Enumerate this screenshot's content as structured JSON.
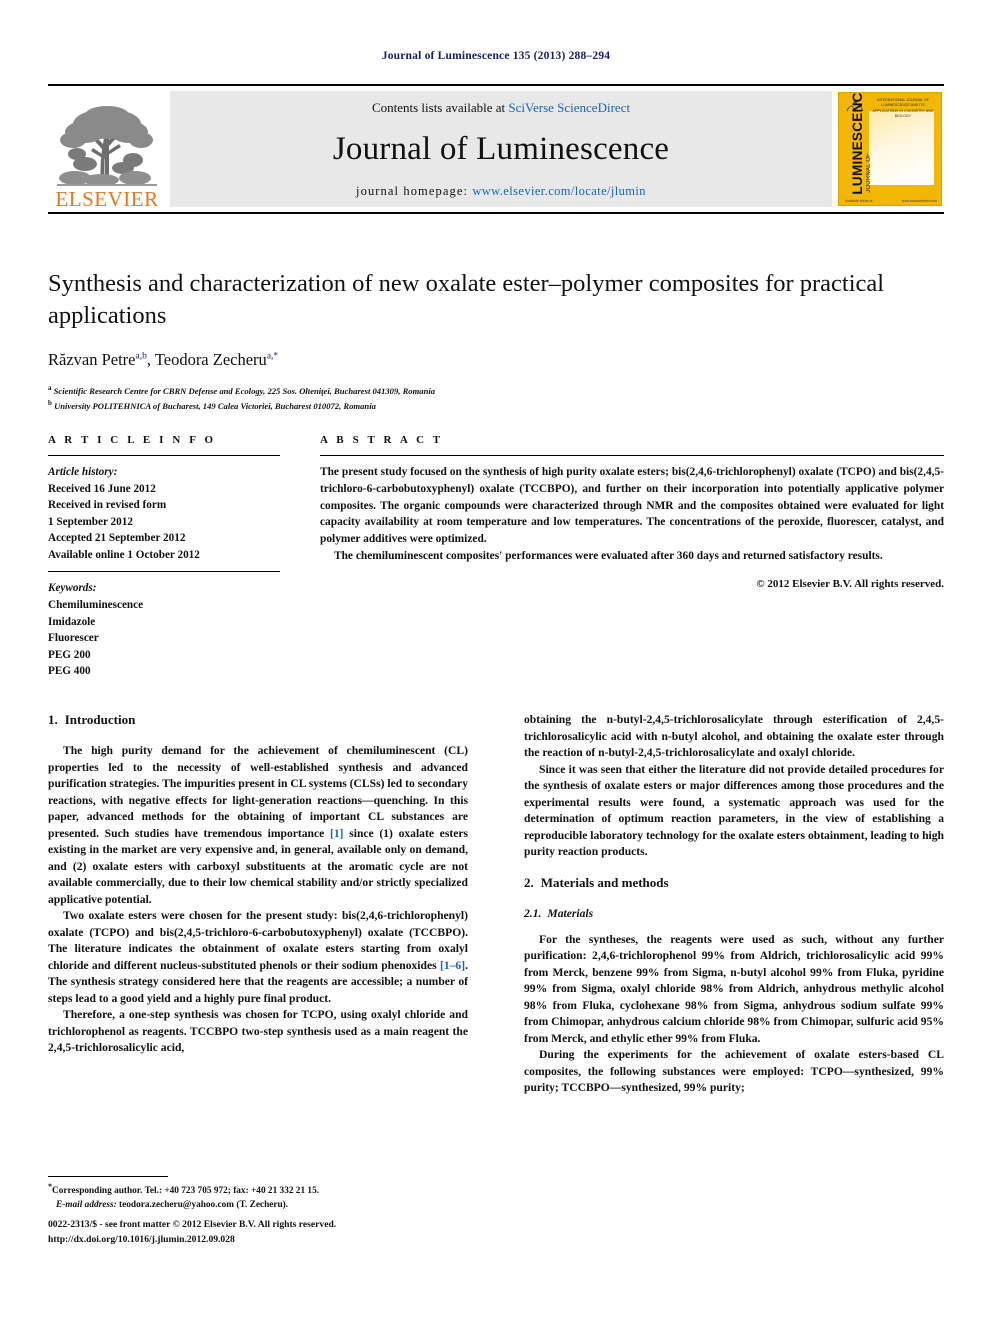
{
  "running_head": "Journal of Luminescence 135 (2013) 288–294",
  "masthead": {
    "publisher_name": "ELSEVIER",
    "contents_prefix": "Contents lists available at ",
    "contents_link": "SciVerse ScienceDirect",
    "journal_title": "Journal of Luminescence",
    "homepage_label": "journal homepage: ",
    "homepage_url": "www.elsevier.com/locate/jlumin",
    "cover": {
      "vertical_title": "LUMINESCENCE",
      "vertical_small": "JOURNAL OF",
      "header_line": "INTERNATIONAL JOURNAL OF LUMINESCENCE AND ITS APPLICATIONS IN CHEMISTRY AND BIOLOGY",
      "footer_left": "Available online at",
      "footer_right": "www.sciencedirect.com"
    }
  },
  "article": {
    "title": "Synthesis and characterization of new oxalate ester–polymer composites for practical applications",
    "authors": [
      {
        "name": "Răzvan Petre",
        "marks": "a,b"
      },
      {
        "name": "Teodora Zecheru",
        "marks": "a,*"
      }
    ],
    "affiliations": [
      {
        "mark": "a",
        "text": "Scientific Research Centre for CBRN Defense and Ecology, 225 Sos. Olteniţei, Bucharest 041309, Romania"
      },
      {
        "mark": "b",
        "text": "University POLITEHNICA of Bucharest, 149 Calea Victoriei, Bucharest 010072, Romania"
      }
    ]
  },
  "article_info": {
    "heading": "A R T I C L E  I N F O",
    "history_label": "Article history:",
    "history": [
      "Received 16 June 2012",
      "Received in revised form",
      "1 September 2012",
      "Accepted 21 September 2012",
      "Available online 1 October 2012"
    ],
    "keywords_label": "Keywords:",
    "keywords": [
      "Chemiluminescence",
      "Imidazole",
      "Fluorescer",
      "PEG 200",
      "PEG 400"
    ]
  },
  "abstract": {
    "heading": "A B S T R A C T",
    "paragraphs": [
      "The present study focused on the synthesis of high purity oxalate esters; bis(2,4,6-trichlorophenyl) oxalate (TCPO) and bis(2,4,5-trichloro-6-carbobutoxyphenyl) oxalate (TCCBPO), and further on their incorporation into potentially applicative polymer composites. The organic compounds were characterized through NMR and the composites obtained were evaluated for light capacity availability at room temperature and low temperatures. The concentrations of the peroxide, fluorescer, catalyst, and polymer additives were optimized.",
      "The chemiluminescent composites' performances were evaluated after 360 days and returned satisfactory results."
    ],
    "copyright": "© 2012 Elsevier B.V. All rights reserved."
  },
  "sections": {
    "introduction": {
      "number": "1.",
      "title": "Introduction",
      "paragraphs": [
        "The high purity demand for the achievement of chemiluminescent (CL) properties led to the necessity of well-established synthesis and advanced purification strategies. The impurities present in CL systems (CLSs) led to secondary reactions, with negative effects for light-generation reactions—quenching. In this paper, advanced methods for the obtaining of important CL substances are presented. Such studies have tremendous importance [1] since (1) oxalate esters existing in the market are very expensive and, in general, available only on demand, and (2) oxalate esters with carboxyl substituents at the aromatic cycle are not available commercially, due to their low chemical stability and/or strictly specialized applicative potential.",
        "Two oxalate esters were chosen for the present study: bis(2,4,6-trichlorophenyl) oxalate (TCPO) and bis(2,4,5-trichloro-6-carbobutoxyphenyl) oxalate (TCCBPO). The literature indicates the obtainment of oxalate esters starting from oxalyl chloride and different nucleus-substituted phenols or their sodium phenoxides [1–6]. The synthesis strategy considered here that the reagents are accessible; a number of steps lead to a good yield and a highly pure final product.",
        "Therefore, a one-step synthesis was chosen for TCPO, using oxalyl chloride and trichlorophenol as reagents. TCCBPO two-step synthesis used as a main reagent the 2,4,5-trichlorosalicylic acid, obtaining the n-butyl-2,4,5-trichlorosalicylate through esterification of 2,4,5-trichlorosalicylic acid with n-butyl alcohol, and obtaining the oxalate ester through the reaction of n-butyl-2,4,5-trichlorosalicylate and oxalyl chloride.",
        "Since it was seen that either the literature did not provide detailed procedures for the synthesis of oxalate esters or major differences among those procedures and the experimental results were found, a systematic approach was used for the determination of optimum reaction parameters, in the view of establishing a reproducible laboratory technology for the oxalate esters obtainment, leading to high purity reaction products."
      ],
      "citations": {
        "first": "[1]",
        "range": "[1–6]"
      }
    },
    "materials_methods": {
      "number": "2.",
      "title": "Materials and methods",
      "subsection": {
        "number": "2.1.",
        "title": "Materials",
        "paragraphs": [
          "For the syntheses, the reagents were used as such, without any further purification: 2,4,6-trichlorophenol 99% from Aldrich, trichlorosalicylic acid 99% from Merck, benzene 99% from Sigma, n-butyl alcohol 99% from Fluka, pyridine 99% from Sigma, oxalyl chloride 98% from Aldrich, anhydrous methylic alcohol 98% from Fluka, cyclohexane 98% from Sigma, anhydrous sodium sulfate 99% from Chimopar, anhydrous calcium chloride 98% from Chimopar, sulfuric acid 95% from Merck, and ethylic ether 99% from Fluka.",
          "During the experiments for the achievement of oxalate esters-based CL composites, the following substances were employed: TCPO—synthesized, 99% purity; TCCBPO—synthesized, 99% purity;"
        ]
      }
    }
  },
  "footnote": {
    "marker": "*",
    "corresponding": "Corresponding author. Tel.: +40 723 705 972; fax: +40 21 332 21 15.",
    "email_label": "E-mail address:",
    "email": "teodora.zecheru@yahoo.com (T. Zecheru)."
  },
  "footer": {
    "front_matter": "0022-2313/$ - see front matter © 2012 Elsevier B.V. All rights reserved.",
    "doi": "http://dx.doi.org/10.1016/j.jlumin.2012.09.028"
  },
  "colors": {
    "elsevier_orange": "#E87722",
    "link_blue": "#1565C0",
    "cover_yellow": "#F2B705",
    "runhead_navy": "#1a1a6e"
  }
}
